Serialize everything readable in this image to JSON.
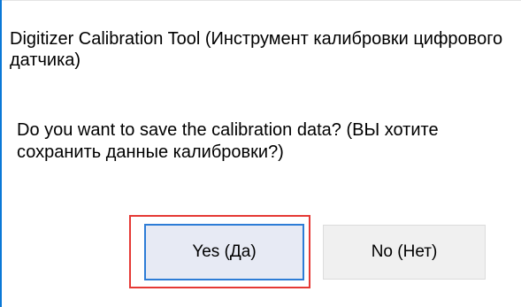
{
  "dialog": {
    "title": "Digitizer Calibration Tool (Инструмент калибровки цифрового датчика)",
    "message": "Do you want to save the calibration data? (ВЫ хотите сохранить данные калибровки?)",
    "buttons": {
      "yes_label": "Yes (Да)",
      "no_label": "No (Нет)"
    },
    "default_button": "yes",
    "colors": {
      "accent": "#2d7cd6",
      "highlight": "#e53935",
      "left_edge": "#0a78d7"
    }
  }
}
